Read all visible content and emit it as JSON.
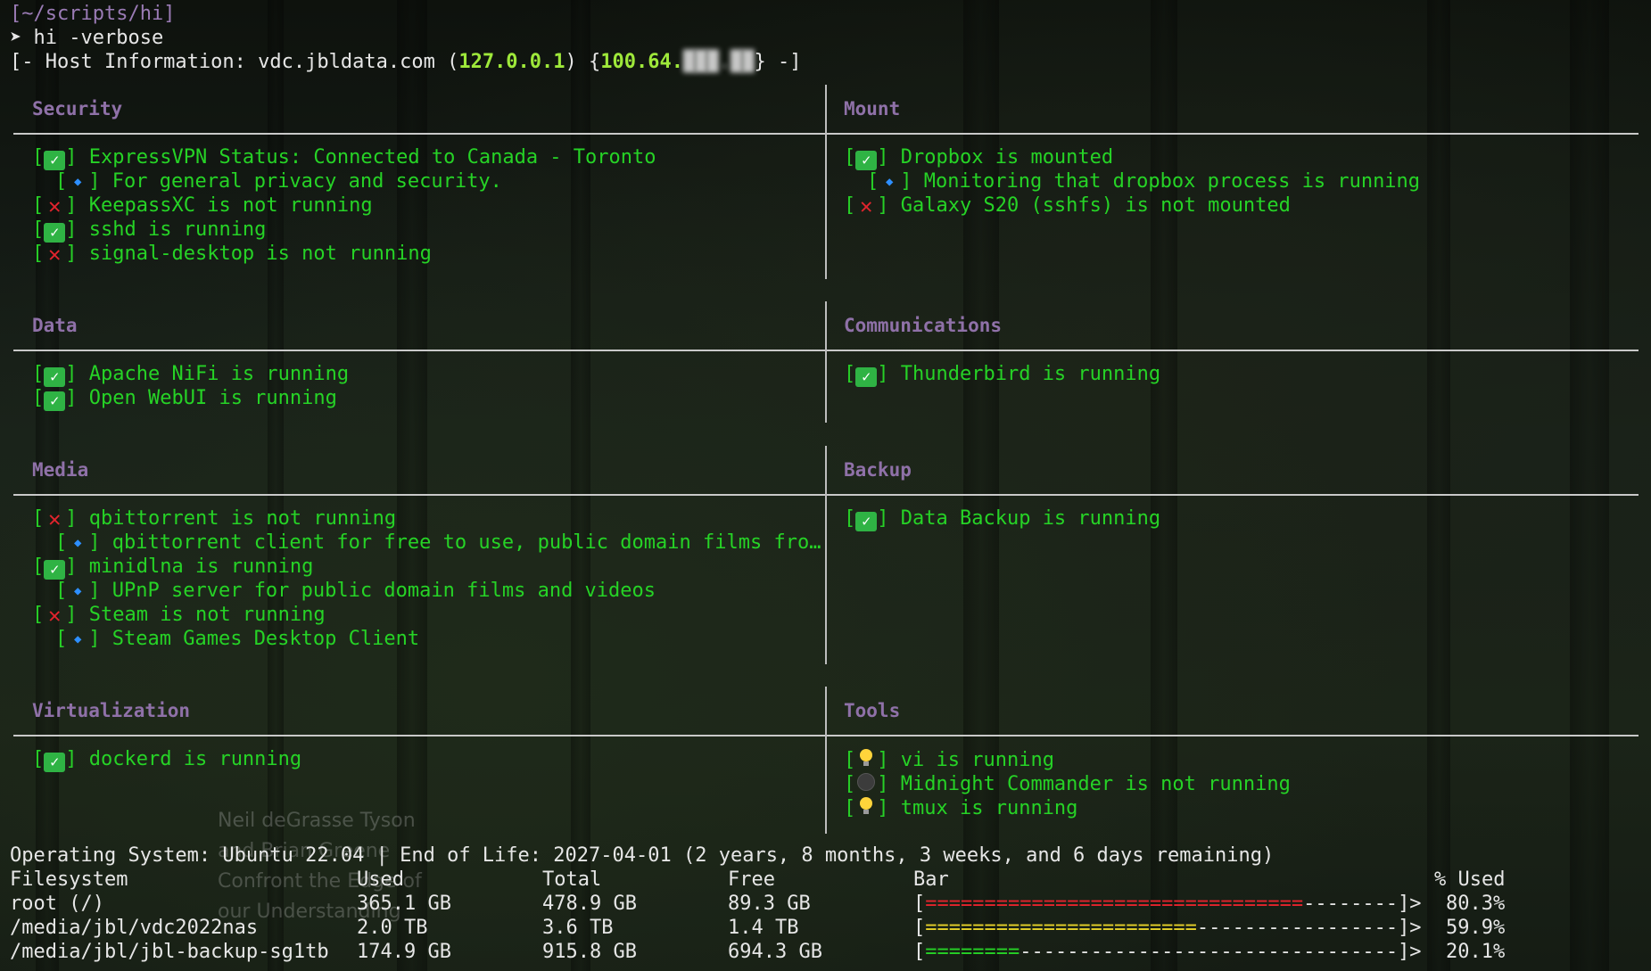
{
  "terminal": {
    "cwd": "[~/scripts/hi]",
    "prompt_symbol": "➤",
    "command": "hi -verbose",
    "host_prefix": "[- Host Information: vdc.jbldata.com (",
    "host_ip": "127.0.0.1",
    "host_mid": ") {",
    "host_ip2": "100.64.",
    "host_ip2_hidden": "███.██",
    "host_suffix": "} -]"
  },
  "sections": {
    "security": {
      "title": "Security",
      "items": [
        {
          "status": "ok",
          "text": "ExpressVPN Status: Connected to Canada - Toronto"
        },
        {
          "status": "info",
          "text": "For general privacy and security."
        },
        {
          "status": "fail",
          "text": "KeepassXC is not running"
        },
        {
          "status": "ok",
          "text": "sshd is running"
        },
        {
          "status": "fail",
          "text": "signal-desktop is not running"
        }
      ]
    },
    "mount": {
      "title": "Mount",
      "items": [
        {
          "status": "ok",
          "text": "Dropbox is mounted"
        },
        {
          "status": "info",
          "text": "Monitoring that dropbox process is running"
        },
        {
          "status": "fail",
          "text": "Galaxy S20 (sshfs) is not mounted"
        }
      ]
    },
    "data": {
      "title": "Data",
      "items": [
        {
          "status": "ok",
          "text": "Apache NiFi is running"
        },
        {
          "status": "ok",
          "text": "Open WebUI is running"
        }
      ]
    },
    "communications": {
      "title": "Communications",
      "items": [
        {
          "status": "ok",
          "text": "Thunderbird is running"
        }
      ]
    },
    "media": {
      "title": "Media",
      "items": [
        {
          "status": "fail",
          "text": "qbittorrent is not running"
        },
        {
          "status": "info",
          "text": "qbittorrent client for free to use, public domain films fro…"
        },
        {
          "status": "ok",
          "text": "minidlna is running"
        },
        {
          "status": "info",
          "text": "UPnP server for public domain films and videos"
        },
        {
          "status": "fail",
          "text": "Steam is not running"
        },
        {
          "status": "info",
          "text": "Steam Games Desktop Client"
        }
      ]
    },
    "backup": {
      "title": "Backup",
      "items": [
        {
          "status": "ok",
          "text": "Data Backup is running"
        }
      ]
    },
    "virtualization": {
      "title": "Virtualization",
      "items": [
        {
          "status": "ok",
          "text": "dockerd is running"
        }
      ]
    },
    "tools": {
      "title": "Tools",
      "items": [
        {
          "status": "bulb",
          "text": "vi is running"
        },
        {
          "status": "off",
          "text": "Midnight Commander is not running"
        },
        {
          "status": "bulb",
          "text": "tmux is running"
        }
      ]
    }
  },
  "system": {
    "os_line": "Operating System: Ubuntu 22.04 | End of Life: 2027-04-01 (2 years, 8 months, 3 weeks, and 6 days remaining)"
  },
  "filesystems": {
    "headers": {
      "filesystem": "Filesystem",
      "used": "Used",
      "total": "Total",
      "free": "Free",
      "bar": "Bar",
      "pct": "% Used"
    },
    "rows": [
      {
        "filesystem": "root (/)",
        "used": "365.1 GB",
        "total": "478.9 GB",
        "free": "89.3 GB",
        "bar_open": "[",
        "bar_fill": "================================",
        "bar_empty": "--------",
        "bar_close": "]>",
        "pct": "80.3%",
        "color": "#e6242d"
      },
      {
        "filesystem": "/media/jbl/vdc2022nas",
        "used": "2.0 TB",
        "total": "3.6 TB",
        "free": "1.4 TB",
        "bar_open": "[",
        "bar_fill": "=======================",
        "bar_empty": "-----------------",
        "bar_close": "]>",
        "pct": "59.9%",
        "color": "#e8d32a"
      },
      {
        "filesystem": "/media/jbl/jbl-backup-sg1tb",
        "used": "174.9 GB",
        "total": "915.8 GB",
        "free": "694.3 GB",
        "bar_open": "[",
        "bar_fill": "========",
        "bar_empty": "--------------------------------",
        "bar_close": "]>",
        "pct": "20.1%",
        "color": "#26d326"
      }
    ]
  },
  "background_overlay": {
    "lines": [
      "Neil deGrasse Tyson",
      "and Brian Greene",
      "Confront the Edge of",
      "our Understanding"
    ]
  }
}
